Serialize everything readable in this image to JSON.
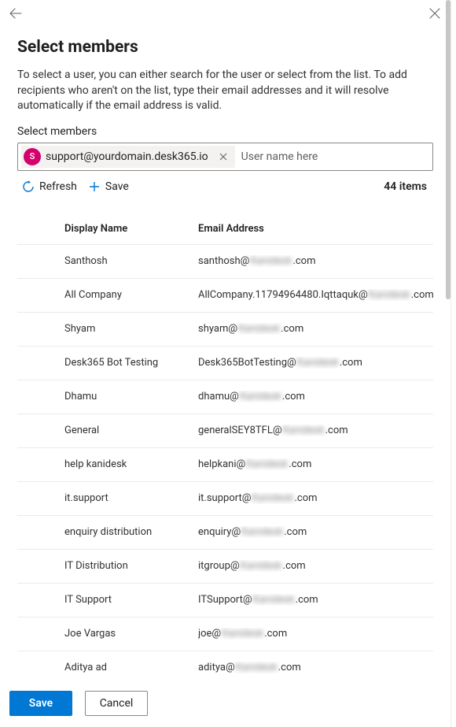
{
  "title": "Select members",
  "description": "To select a user, you can either search for the user or select from the list. To add recipients who aren't on the list, type their email addresses and it will resolve automatically if the email address is valid.",
  "members_label": "Select members",
  "chip": {
    "avatar_letter": "S",
    "text": "support@yourdomain.desk365.io"
  },
  "search_placeholder": "User name here",
  "toolbar": {
    "refresh_label": "Refresh",
    "save_label": "Save"
  },
  "item_count": "44 items",
  "columns": {
    "name": "Display Name",
    "email": "Email Address"
  },
  "rows": [
    {
      "name": "Santhosh",
      "email_pre": "santhosh@",
      "email_blur": "Kanidesk",
      "email_post": ".com"
    },
    {
      "name": "All Company",
      "email_pre": "AllCompany.11794964480.Iqttaquk@",
      "email_blur": "Kanidesk",
      "email_post": ".com"
    },
    {
      "name": "Shyam",
      "email_pre": "shyam@",
      "email_blur": "Kanidesk",
      "email_post": ".com"
    },
    {
      "name": "Desk365 Bot Testing",
      "email_pre": "Desk365BotTesting@",
      "email_blur": "Kanidesk",
      "email_post": ".com"
    },
    {
      "name": "Dhamu",
      "email_pre": "dhamu@",
      "email_blur": "Kanidesk",
      "email_post": ".com"
    },
    {
      "name": "General",
      "email_pre": "generalSEY8TFL@",
      "email_blur": "Kanidesk",
      "email_post": ".com"
    },
    {
      "name": "help kanidesk",
      "email_pre": "helpkani@",
      "email_blur": "Kanidesk",
      "email_post": ".com"
    },
    {
      "name": "it.support",
      "email_pre": "it.support@",
      "email_blur": "Kanidesk",
      "email_post": ".com"
    },
    {
      "name": "enquiry distribution",
      "email_pre": "enquiry@",
      "email_blur": "Kanidesk",
      "email_post": ".com"
    },
    {
      "name": "IT Distribution",
      "email_pre": "itgroup@",
      "email_blur": "Kanidesk",
      "email_post": ".com"
    },
    {
      "name": "IT Support",
      "email_pre": "ITSupport@",
      "email_blur": "Kanidesk",
      "email_post": ".com"
    },
    {
      "name": "Joe Vargas",
      "email_pre": "joe@",
      "email_blur": "Kanidesk",
      "email_post": ".com"
    },
    {
      "name": "Aditya ad",
      "email_pre": "aditya@",
      "email_blur": "Kanidesk",
      "email_post": ".com"
    }
  ],
  "footer": {
    "save": "Save",
    "cancel": "Cancel"
  }
}
